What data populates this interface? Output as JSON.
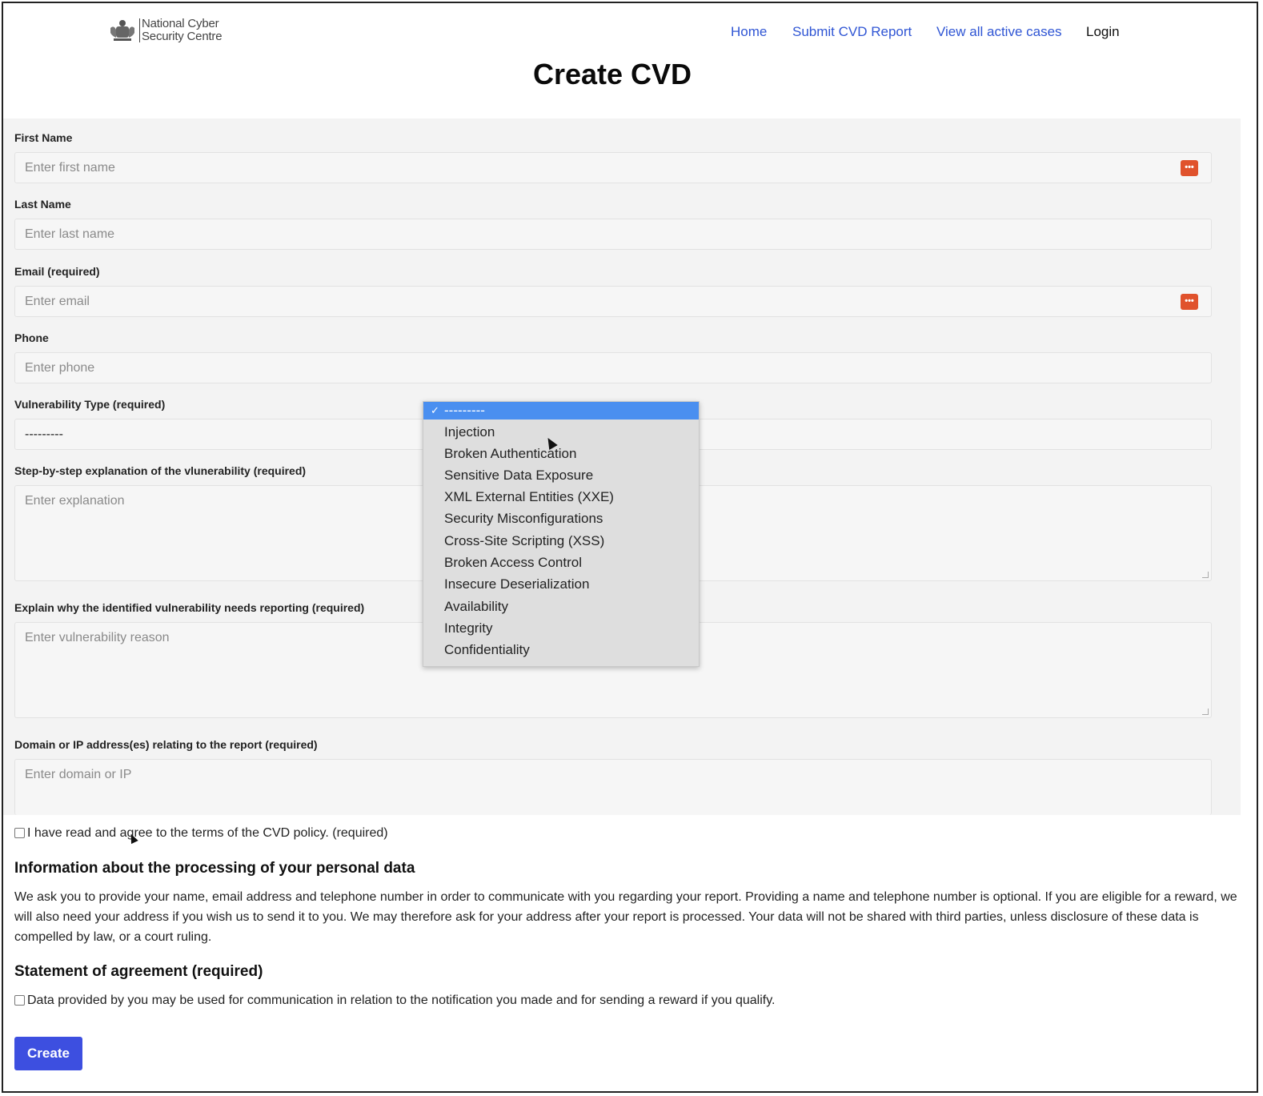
{
  "header": {
    "logo_line1": "National Cyber",
    "logo_line2": "Security Centre",
    "nav": {
      "home": "Home",
      "submit": "Submit CVD Report",
      "view_cases": "View all active cases",
      "login": "Login"
    }
  },
  "page": {
    "title": "Create CVD"
  },
  "form": {
    "first_name": {
      "label": "First Name",
      "placeholder": "Enter first name"
    },
    "last_name": {
      "label": "Last Name",
      "placeholder": "Enter last name"
    },
    "email": {
      "label": "Email (required)",
      "placeholder": "Enter email"
    },
    "phone": {
      "label": "Phone",
      "placeholder": "Enter phone"
    },
    "vuln_type": {
      "label": "Vulnerability Type (required)",
      "selected": "---------",
      "options": [
        "---------",
        "Injection",
        "Broken Authentication",
        "Sensitive Data Exposure",
        "XML External Entities (XXE)",
        "Security Misconfigurations",
        "Cross-Site Scripting (XSS)",
        "Broken Access Control",
        "Insecure Deserialization",
        "Availability",
        "Integrity",
        "Confidentiality"
      ]
    },
    "explanation": {
      "label": "Step-by-step explanation of the vlunerability (required)",
      "placeholder": "Enter explanation"
    },
    "reason": {
      "label": "Explain why the identified vulnerability needs reporting (required)",
      "placeholder": "Enter vulnerability reason"
    },
    "domain": {
      "label": "Domain or IP address(es) relating to the report (required)",
      "placeholder": "Enter domain or IP"
    }
  },
  "policy_checkbox": "I have read and agree to the terms of the CVD policy. (required)",
  "info": {
    "heading": "Information about the processing of your personal data",
    "text": "We ask you to provide your name, email address and telephone number in order to communicate with you regarding your report. Providing a name and telephone number is optional. If you are eligible for a reward, we will also need your address if you wish us to send it to you. We may therefore ask for your address after your report is processed. Your data will not be shared with third parties, unless disclosure of these data is compelled by law, or a court ruling."
  },
  "agreement": {
    "heading": "Statement of agreement (required)",
    "checkbox": "Data provided by you may be used for communication in relation to the notification you made and for sending a reward if you qualify."
  },
  "submit_label": "Create",
  "icons": {
    "password_manager": "password-manager-icon",
    "crest": "royal-crest-icon"
  },
  "colors": {
    "link": "#2f55d4",
    "button": "#3d4fe0",
    "password_icon": "#e0522c",
    "dropdown_highlight": "#4a8ff0"
  }
}
